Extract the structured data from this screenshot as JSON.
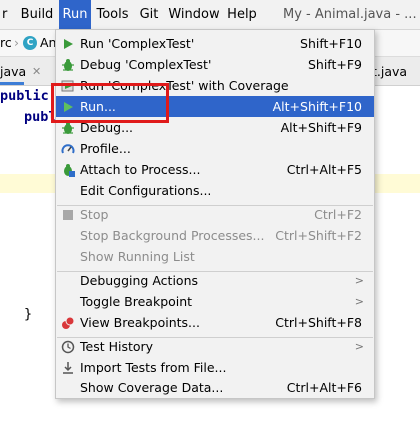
{
  "menubar": {
    "items": [
      "r",
      "Build",
      "Run",
      "Tools",
      "Git",
      "Window",
      "Help"
    ],
    "active": "Run",
    "title": "My - Animal.java - ..."
  },
  "breadcrumb": {
    "items": [
      "rc",
      "An"
    ]
  },
  "tabs": {
    "items": [
      "java",
      "t.java"
    ]
  },
  "code": {
    "line1_kw": "public",
    "line1_rest": "c",
    "line2_kw": "publ",
    "line3": "}"
  },
  "run_menu": {
    "items": {
      "run_config": {
        "label": "Run 'ComplexTest'",
        "shortcut": "Shift+F10"
      },
      "debug_config": {
        "label": "Debug 'ComplexTest'",
        "shortcut": "Shift+F9"
      },
      "coverage_config": {
        "label": "Run 'ComplexTest' with Coverage",
        "shortcut": ""
      },
      "run": {
        "label": "Run...",
        "shortcut": "Alt+Shift+F10"
      },
      "debug": {
        "label": "Debug...",
        "shortcut": "Alt+Shift+F9"
      },
      "profile": {
        "label": "Profile...",
        "shortcut": ""
      },
      "attach": {
        "label": "Attach to Process...",
        "shortcut": "Ctrl+Alt+F5"
      },
      "edit_configs": {
        "label": "Edit Configurations...",
        "shortcut": ""
      },
      "stop": {
        "label": "Stop",
        "shortcut": "Ctrl+F2"
      },
      "stop_bg": {
        "label": "Stop Background Processes...",
        "shortcut": "Ctrl+Shift+F2"
      },
      "show_running": {
        "label": "Show Running List",
        "shortcut": ""
      },
      "debugging_actions": {
        "label": "Debugging Actions",
        "shortcut": ""
      },
      "toggle_breakpoint": {
        "label": "Toggle Breakpoint",
        "shortcut": ""
      },
      "view_breakpoints": {
        "label": "View Breakpoints...",
        "shortcut": "Ctrl+Shift+F8"
      },
      "test_history": {
        "label": "Test History",
        "shortcut": ""
      },
      "import_tests": {
        "label": "Import Tests from File...",
        "shortcut": ""
      },
      "show_coverage": {
        "label": "Show Coverage Data...",
        "shortcut": "Ctrl+Alt+F6"
      }
    },
    "highlighted": "run"
  },
  "colors": {
    "accent": "#2f65ca",
    "highlight_box": "#e01a1a",
    "run_green": "#3a9a3a"
  }
}
